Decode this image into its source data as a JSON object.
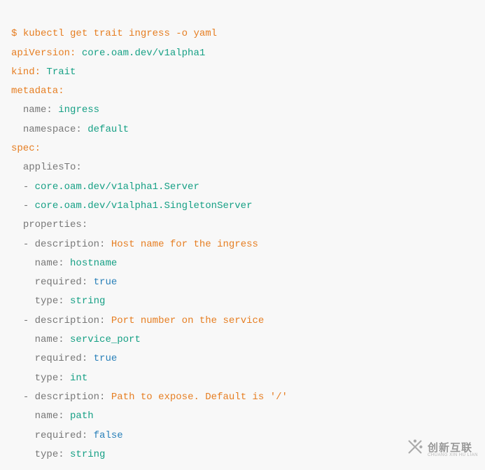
{
  "cmd": {
    "prompt": "$",
    "command": "kubectl get trait ingress",
    "flag_dash": "-",
    "flag_rest": "o yaml"
  },
  "yaml": {
    "apiVersion_key": "apiVersion:",
    "apiVersion_val": "core.oam.dev/v1alpha1",
    "kind_key": "kind:",
    "kind_val": "Trait",
    "metadata_key": "metadata:",
    "metadata": {
      "name_key": "name:",
      "name_val": "ingress",
      "namespace_key": "namespace:",
      "namespace_val": "default"
    },
    "spec_key": "spec:",
    "spec": {
      "appliesTo_key": "appliesTo:",
      "appliesTo": [
        "core.oam.dev/v1alpha1.Server",
        "core.oam.dev/v1alpha1.SingletonServer"
      ],
      "properties_key": "properties:",
      "props": [
        {
          "description_key": "description:",
          "description_val": "Host name for the ingress",
          "name_key": "name:",
          "name_val": "hostname",
          "required_key": "required:",
          "required_val": "true",
          "type_key": "type:",
          "type_val": "string"
        },
        {
          "description_key": "description:",
          "description_val": "Port number on the service",
          "name_key": "name:",
          "name_val": "service_port",
          "required_key": "required:",
          "required_val": "true",
          "type_key": "type:",
          "type_val": "int"
        },
        {
          "description_key": "description:",
          "description_val": "Path to expose. Default is '/'",
          "name_key": "name:",
          "name_val": "path",
          "required_key": "required:",
          "required_val": "false",
          "type_key": "type:",
          "type_val": "string"
        }
      ]
    }
  },
  "watermark": {
    "main": "创新互联",
    "sub": "CHUANG XIN HU LIAN"
  }
}
